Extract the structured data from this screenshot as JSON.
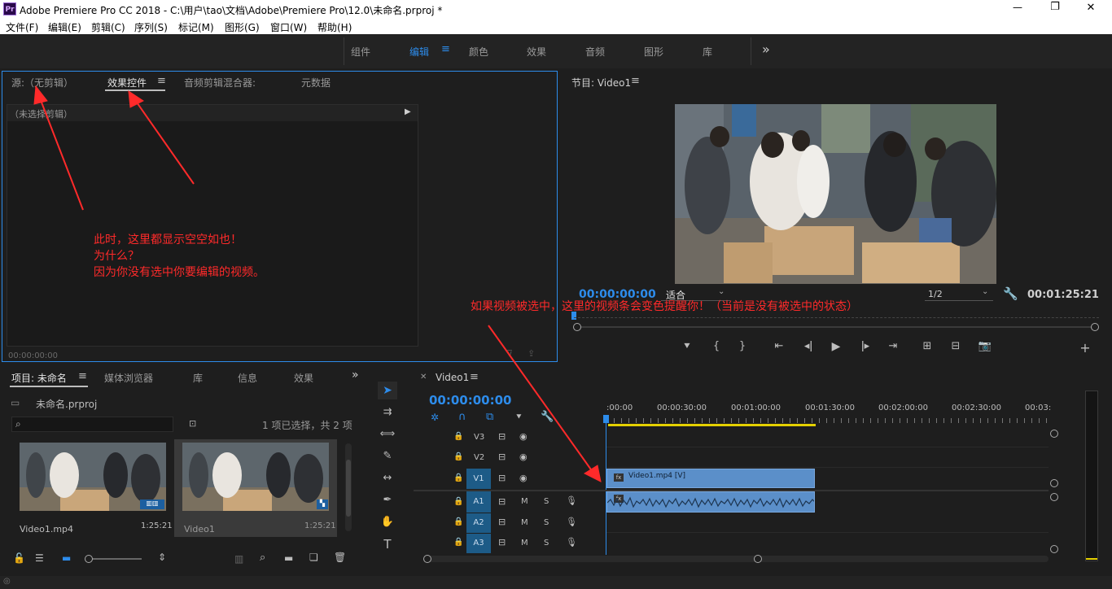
{
  "window": {
    "title": "Adobe Premiere Pro CC 2018 - C:\\用户\\tao\\文档\\Adobe\\Premiere Pro\\12.0\\未命名.prproj *",
    "app_icon_text": "Pr",
    "minimize": "—",
    "maximize": "❐",
    "close": "✕"
  },
  "menu": [
    "文件(F)",
    "编辑(E)",
    "剪辑(C)",
    "序列(S)",
    "标记(M)",
    "图形(G)",
    "窗口(W)",
    "帮助(H)"
  ],
  "workspaces": [
    "组件",
    "编辑",
    "颜色",
    "效果",
    "音频",
    "图形",
    "库"
  ],
  "workspace_active": "编辑",
  "workspace_more": "»",
  "source_panel": {
    "tabs": [
      "源:（无剪辑）",
      "效果控件",
      "音频剪辑混合器:",
      "元数据"
    ],
    "active_tab": "效果控件",
    "no_clip_text": "（未选择剪辑）",
    "timecode": "00:00:00:00"
  },
  "program_monitor": {
    "title": "节目: Video1",
    "timecode": "00:00:00:00",
    "fit": "适合",
    "resolution": "1/2",
    "duration": "00:01:25:21"
  },
  "project_panel": {
    "tabs": [
      "项目: 未命名",
      "媒体浏览器",
      "库",
      "信息",
      "效果"
    ],
    "project_file": "未命名.prproj",
    "selection_info": "1 项已选择，共 2 项",
    "items": [
      {
        "name": "Video1.mp4",
        "duration": "1:25:21"
      },
      {
        "name": "Video1",
        "duration": "1:25:21"
      }
    ]
  },
  "timeline": {
    "tab": "Video1",
    "timecode": "00:00:00:00",
    "ruler": [
      ":00:00",
      "00:00:30:00",
      "00:01:00:00",
      "00:01:30:00",
      "00:02:00:00",
      "00:02:30:00",
      "00:03:"
    ],
    "video_tracks": [
      "V3",
      "V2",
      "V1"
    ],
    "audio_tracks": [
      "A1",
      "A2",
      "A3"
    ],
    "source_v": "V1",
    "source_a": "A1",
    "clip_label": "Video1.mp4 [V]",
    "fx_badge": "fx",
    "mute": "M",
    "solo": "S"
  },
  "annotations": {
    "left_lines": [
      "此时，这里都显示空空如也！",
      "为什么？",
      "因为你没有选中你要编辑的视频。"
    ],
    "center": "如果视频被选中，这里的视频条会变色提醒你！（当前是没有被选中的状态）"
  },
  "colors": {
    "accent_blue": "#2d8ceb",
    "clip_blue": "#5b8fc9",
    "annotation_red": "#ff2a2a",
    "panel_bg": "#1e1e1e"
  }
}
